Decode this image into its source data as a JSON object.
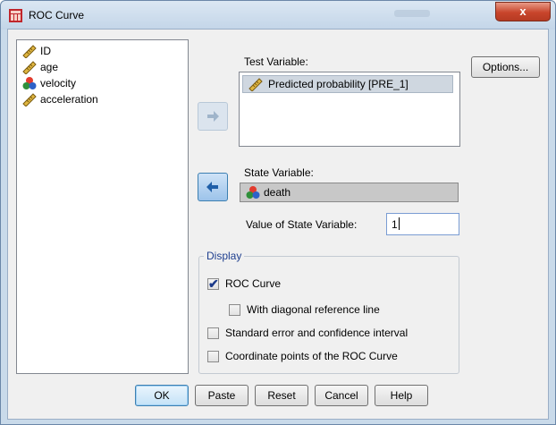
{
  "window": {
    "title": "ROC Curve",
    "close_glyph": "x"
  },
  "variables": [
    {
      "name": "ID",
      "icon": "ruler-scale-icon"
    },
    {
      "name": "age",
      "icon": "ruler-scale-icon"
    },
    {
      "name": "velocity",
      "icon": "nominal-circles-icon"
    },
    {
      "name": "acceleration",
      "icon": "ruler-scale-icon"
    }
  ],
  "test_variable": {
    "label": "Test Variable:",
    "item": "Predicted probability [PRE_1]",
    "item_icon": "ruler-scale-icon"
  },
  "state_variable": {
    "label": "State Variable:",
    "item": "death",
    "item_icon": "nominal-circles-icon"
  },
  "value_of_state": {
    "label": "Value of State Variable:",
    "value": "1"
  },
  "options_button": "Options...",
  "display": {
    "legend": "Display",
    "roc_curve": {
      "label": "ROC Curve",
      "checked": true
    },
    "diagonal": {
      "label": "With diagonal reference line",
      "checked": false
    },
    "std_error": {
      "label": "Standard error and confidence interval",
      "checked": false
    },
    "coordinates": {
      "label": "Coordinate points of the ROC Curve",
      "checked": false
    }
  },
  "buttons": {
    "ok": "OK",
    "paste": "Paste",
    "reset": "Reset",
    "cancel": "Cancel",
    "help": "Help"
  },
  "colors": {
    "window_frame": "#c9daea",
    "client": "#f0f0f0",
    "accent_blue": "#3c7fb1",
    "close_red": "#c8452c"
  }
}
